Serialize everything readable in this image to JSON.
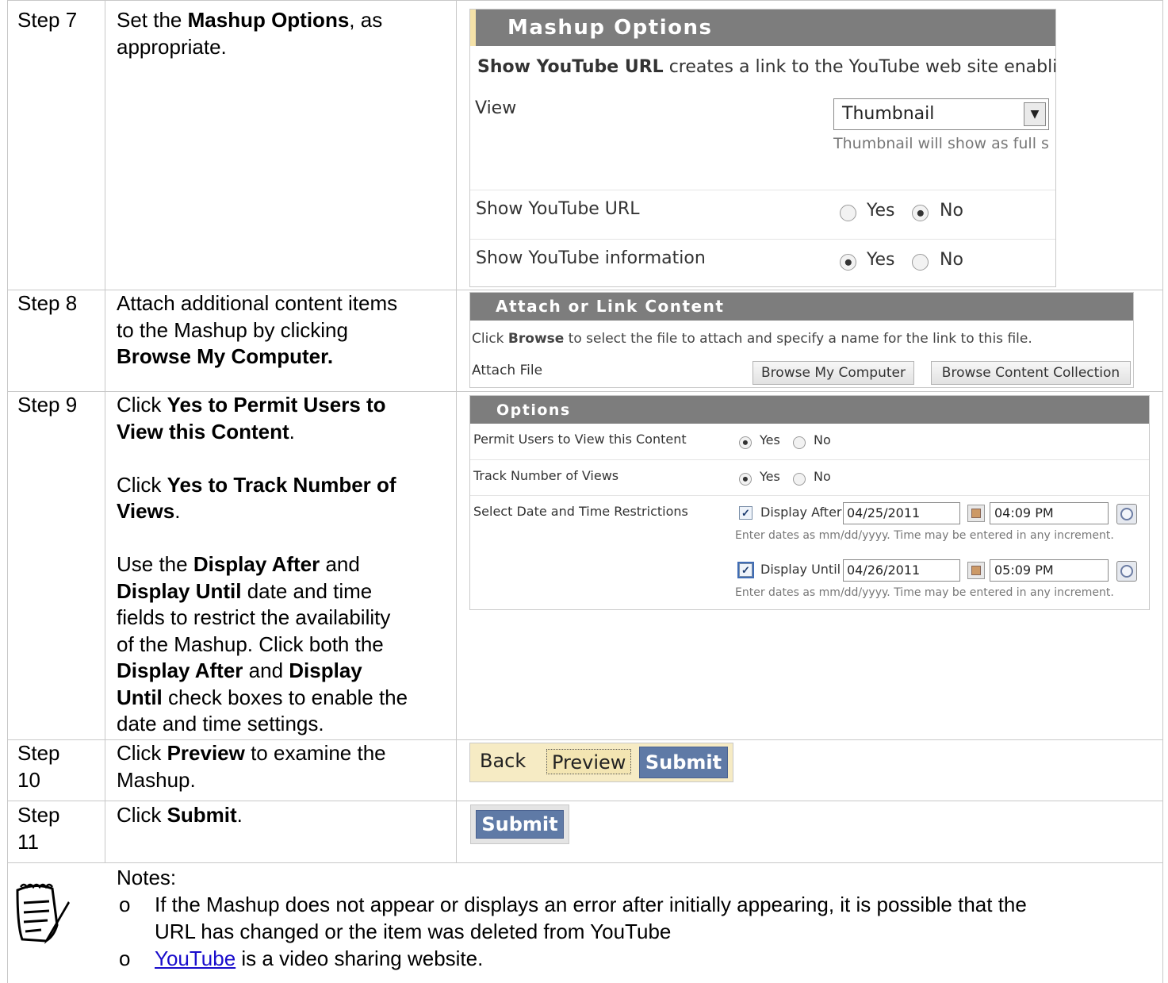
{
  "steps": {
    "s7": {
      "label": "Step 7"
    },
    "s8": {
      "label": "Step 8",
      "text_1": "Attach additional content items",
      "text_2": "to the Mashup by clicking",
      "text_3": "Browse My Computer."
    },
    "s9": {
      "label": "Step 9"
    },
    "s10": {
      "label_1": "Step",
      "label_2": "10",
      "pre": "Click ",
      "bold": "Preview",
      "post": " to examine the",
      "line2": "Mashup."
    },
    "s11": {
      "label_1": "Step",
      "label_2": "11",
      "pre": "Click ",
      "bold": "Submit",
      "post": "."
    }
  },
  "step7_text": {
    "pre": "Set the ",
    "bold": "Mashup Options",
    "post": ", as",
    "line2": "appropriate."
  },
  "step9_text": {
    "l1_pre": "Click ",
    "l1_bold": "Yes to Permit Users to",
    "l2_bold": "View this Content",
    "l2_post": ".",
    "l3_pre": "Click ",
    "l3_bold": "Yes to Track Number of",
    "l4_bold": "Views",
    "l4_post": ".",
    "l5_pre": "Use the ",
    "l5_bold": "Display After",
    "l5_post": " and",
    "l6_bold": "Display Until",
    "l6_post": " date and time",
    "l7": "fields to restrict the availability",
    "l8": "of the Mashup. Click both the",
    "l9_bold1": "Display After",
    "l9_mid": " and ",
    "l9_bold2": "Display",
    "l10_bold": "Until",
    "l10_post": " check boxes to enable the",
    "l11": "date and time settings."
  },
  "mashup_options": {
    "title": "Mashup Options",
    "desc_bold": "Show YouTube URL",
    "desc_rest": " creates a link to the YouTube web site enablin",
    "view_label": "View",
    "view_value": "Thumbnail",
    "view_hint": "Thumbnail will show as full s",
    "url_label": "Show YouTube URL",
    "info_label": "Show YouTube information",
    "yes": "Yes",
    "no": "No"
  },
  "attach": {
    "title": "Attach or Link Content",
    "desc_pre": "Click ",
    "desc_bold": "Browse",
    "desc_post": " to select the file to attach and specify a name for the link to this file.",
    "file_label": "Attach File",
    "browse_computer": "Browse My Computer",
    "browse_collection": "Browse Content Collection"
  },
  "options": {
    "title": "Options",
    "permit_label": "Permit Users to View this Content",
    "track_label": "Track Number of Views",
    "restrict_label": "Select Date and Time Restrictions",
    "yes": "Yes",
    "no": "No",
    "display_after": "Display After",
    "after_date": "04/25/2011",
    "after_time": "04:09 PM",
    "display_until": "Display Until",
    "until_date": "04/26/2011",
    "until_time": "05:09 PM",
    "hint": "Enter dates as mm/dd/yyyy. Time may be entered in any increment."
  },
  "buttons": {
    "back": "Back",
    "preview": "Preview",
    "submit": "Submit",
    "submit2": "Submit"
  },
  "notes": {
    "heading": "Notes:",
    "bullet": "o",
    "n1_l1": "If the Mashup does not appear or displays an error after initially appearing, it is possible that the",
    "n1_l2": "URL has changed or the item was deleted from YouTube",
    "n2_link": "YouTube",
    "n2_rest": " is a video sharing website."
  },
  "colors": {
    "title_bar": "#7a7a7a",
    "accent_tab": "#f5e2a8",
    "submit_blue": "#5f7aa6",
    "button_bar": "#f6ebc4",
    "link": "#1a0dcc"
  }
}
